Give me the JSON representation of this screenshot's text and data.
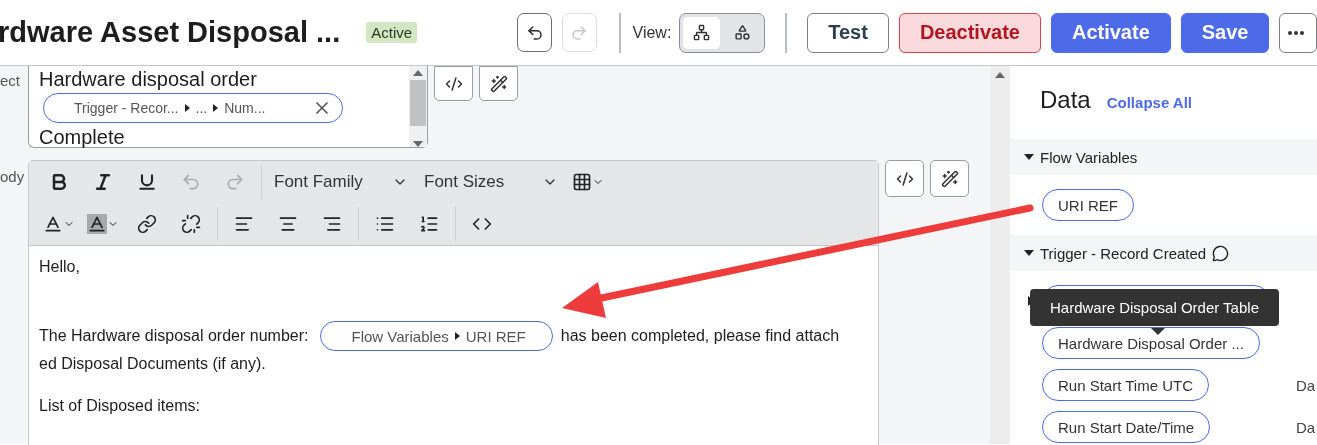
{
  "header": {
    "title": "rdware Asset Disposal ...",
    "status": "Active",
    "undo": {
      "disabled": false
    },
    "redo": {
      "disabled": true
    },
    "view_label": "View:",
    "view_options": [
      {
        "kind": "tree",
        "selected": true
      },
      {
        "kind": "shapes",
        "selected": false
      }
    ],
    "buttons": [
      {
        "kind": "outline",
        "label": "Test"
      },
      {
        "kind": "danger",
        "label": "Deactivate"
      },
      {
        "kind": "primary",
        "label": "Activate"
      },
      {
        "kind": "primary",
        "label": "Save"
      },
      {
        "kind": "more"
      }
    ]
  },
  "subject": {
    "label": "ect",
    "lines": [
      {
        "kind": "text",
        "text": "Hardware disposal order"
      },
      {
        "kind": "pill",
        "segments": [
          "Trigger - Recor...",
          "...",
          "Num..."
        ]
      },
      {
        "kind": "text",
        "text": "Complete"
      }
    ]
  },
  "body": {
    "label": "ody",
    "toolbar": {
      "undo": {
        "disabled": true
      },
      "redo": {
        "disabled": true
      },
      "font_family": "Font Family",
      "font_sizes": "Font Sizes"
    },
    "paragraphs": [
      {
        "kind": "text",
        "text": "Hello,"
      },
      {
        "kind": "blank"
      },
      {
        "kind": "mixed",
        "before": "The Hardware disposal order number:",
        "pill": [
          "Flow Variables",
          "URI REF"
        ],
        "after": "has been completed, please find attach",
        "continuation": "ed Disposal Documents (if any)."
      },
      {
        "kind": "text",
        "text": "List of Disposed items:"
      }
    ]
  },
  "data_panel": {
    "title": "Data",
    "collapse_link": "Collapse All",
    "sections": [
      {
        "title": "Flow Variables",
        "expanded": true,
        "comment": false,
        "items": [
          {
            "label": "URI REF"
          }
        ]
      },
      {
        "title": "Trigger - Record Created",
        "expanded": true,
        "comment": true,
        "items": [
          {
            "kind": "covered"
          },
          {
            "label": "Hardware Disposal Order ..."
          },
          {
            "label": "Run Start Time UTC",
            "column_2": "Da"
          },
          {
            "label": "Run Start Date/Time",
            "column_2": "Da"
          }
        ]
      }
    ],
    "tooltip": "Hardware Disposal Order Table"
  }
}
